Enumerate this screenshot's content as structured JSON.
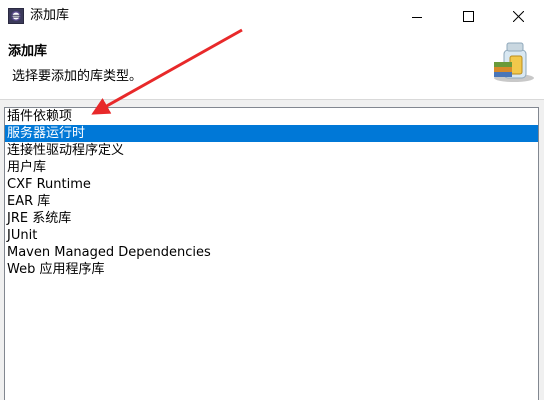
{
  "window": {
    "title": "添加库",
    "controls": [
      "minimize-icon",
      "maximize-icon",
      "close-icon"
    ]
  },
  "header": {
    "title": "添加库",
    "description": "选择要添加的库类型。",
    "image_icon": "library-jars-icon"
  },
  "library_types": {
    "selected_index": 1,
    "items": [
      {
        "label": "插件依赖项"
      },
      {
        "label": "服务器运行时"
      },
      {
        "label": "连接性驱动程序定义"
      },
      {
        "label": "用户库"
      },
      {
        "label": "CXF Runtime"
      },
      {
        "label": "EAR 库"
      },
      {
        "label": "JRE 系统库"
      },
      {
        "label": "JUnit"
      },
      {
        "label": "Maven Managed Dependencies"
      },
      {
        "label": "Web 应用程序库"
      }
    ]
  },
  "annotation": {
    "icon": "red-arrow-annotation",
    "color": "#e8292a"
  },
  "colors": {
    "selection": "#0078d7",
    "list_border": "#828790",
    "dialog_background": "#f0f0f0"
  }
}
